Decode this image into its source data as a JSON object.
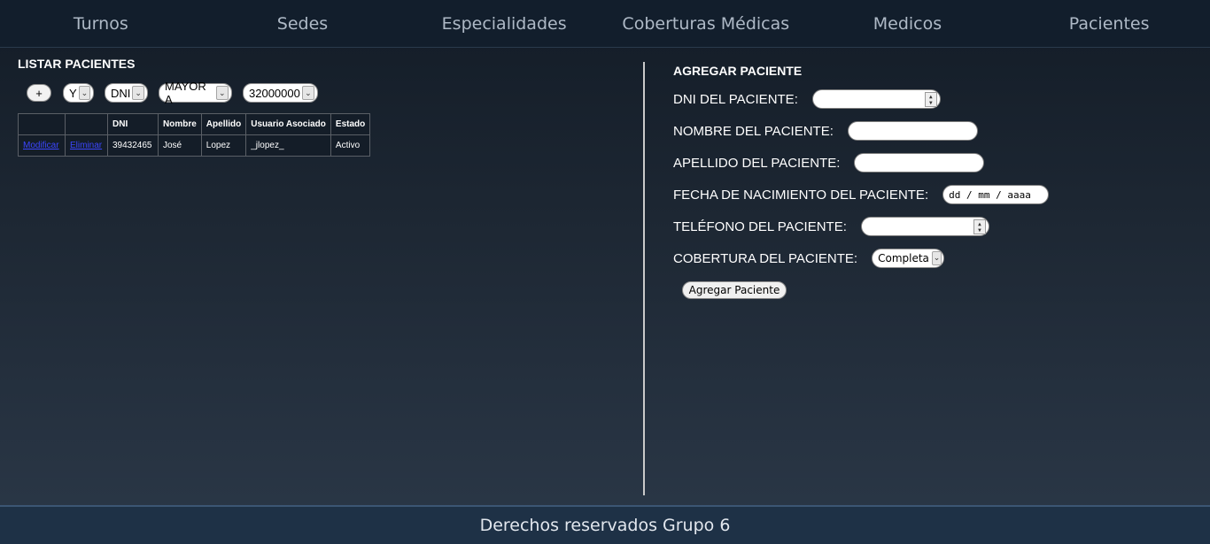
{
  "nav": {
    "items": [
      "Turnos",
      "Sedes",
      "Especialidades",
      "Coberturas Médicas",
      "Medicos",
      "Pacientes"
    ]
  },
  "list": {
    "title": "LISTAR PACIENTES",
    "filters": {
      "add_label": "+",
      "connector": "Y",
      "field": "DNI",
      "operator": "MAYOR A",
      "value": "32000000"
    },
    "table": {
      "headers": [
        "",
        "",
        "DNI",
        "Nombre",
        "Apellido",
        "Usuario Asociado",
        "Estado"
      ],
      "rows": [
        {
          "modify_label": "Modificar",
          "delete_label": "Eliminar",
          "dni": "39432465",
          "nombre": "José",
          "apellido": "Lopez",
          "usuario": "_jlopez_",
          "estado": "Activo"
        }
      ]
    }
  },
  "form": {
    "title": "AGREGAR PACIENTE",
    "dni_label": "DNI DEL PACIENTE:",
    "nombre_label": "NOMBRE DEL PACIENTE:",
    "apellido_label": "APELLIDO DEL PACIENTE:",
    "fecha_label": "FECHA DE NACIMIENTO DEL PACIENTE:",
    "fecha_placeholder": "dd / mm / aaaa",
    "telefono_label": "TELÉFONO DEL PACIENTE:",
    "cobertura_label": "COBERTURA DEL PACIENTE:",
    "cobertura_value": "Completa",
    "submit_label": "Agregar Paciente"
  },
  "footer": {
    "text": "Derechos reservados Grupo 6"
  }
}
